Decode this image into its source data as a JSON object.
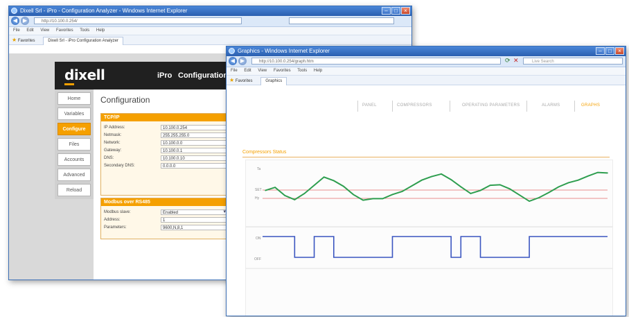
{
  "window1": {
    "title": "Dixell Srl - iPro - Configuration Analyzer - Windows Internet Explorer",
    "address": "http://10.100.0.254/",
    "menu": [
      "File",
      "Edit",
      "View",
      "Favorites",
      "Tools",
      "Help"
    ],
    "favorites_label": "Favorites",
    "tab_label": "Dixell Srl - iPro Configuration Analyzer",
    "header": {
      "logo": "dixell",
      "product": "iPro",
      "section": "Configuration"
    },
    "sidebar": [
      {
        "label": "Home",
        "active": false
      },
      {
        "label": "Variables",
        "active": false
      },
      {
        "label": "Configure",
        "active": true
      },
      {
        "label": "Files",
        "active": false
      },
      {
        "label": "Accounts",
        "active": false
      },
      {
        "label": "Advanced",
        "active": false
      },
      {
        "label": "Reload",
        "active": false
      }
    ],
    "page_title": "Configuration",
    "tcpip": {
      "title": "TCP/IP",
      "rows": [
        {
          "label": "IP Address:",
          "value": "10.100.0.254"
        },
        {
          "label": "Netmask:",
          "value": "255.255.255.0"
        },
        {
          "label": "Network:",
          "value": "10.100.0.0"
        },
        {
          "label": "Gateway:",
          "value": "10.100.0.1"
        },
        {
          "label": "DNS:",
          "value": "10.100.0.10"
        },
        {
          "label": "Secondary DNS:",
          "value": "0.0.0.0"
        }
      ]
    },
    "modbus": {
      "title": "Modbus over RS485",
      "rows": [
        {
          "label": "Modbus slave:",
          "value": "Enabled"
        },
        {
          "label": "Address:",
          "value": "1"
        },
        {
          "label": "Parameters:",
          "value": "9600,N,8,1"
        }
      ]
    }
  },
  "window2": {
    "title": "Graphics - Windows Internet Explorer",
    "address": "http://10.100.0.254/graph.htm",
    "search_placeholder": "Live Search",
    "menu": [
      "File",
      "Edit",
      "View",
      "Favorites",
      "Tools",
      "Help"
    ],
    "favorites_label": "Favorites",
    "tab_label": "Graphics",
    "nav": [
      {
        "label": "PANEL",
        "active": false
      },
      {
        "label": "COMPRESSORS",
        "active": false
      },
      {
        "label": "OPERATING PARAMETERS",
        "active": false
      },
      {
        "label": "ALARMS",
        "active": false
      },
      {
        "label": "GRAPHS",
        "active": true
      }
    ],
    "chart_title": "Compressors Status",
    "y_labels": {
      "top": "Ta",
      "upper_ref": "SET",
      "lower_ref": "Hy",
      "on": "ON",
      "off": "OFF"
    }
  },
  "chart_data": {
    "type": "line",
    "title": "Compressors Status",
    "series": [
      {
        "name": "",
        "color": "#2e9e4f",
        "values": [
          0.52,
          0.58,
          0.42,
          0.34,
          0.46,
          0.62,
          0.78,
          0.71,
          0.6,
          0.44,
          0.33,
          0.36,
          0.36,
          0.44,
          0.5,
          0.61,
          0.72,
          0.79,
          0.84,
          0.73,
          0.59,
          0.46,
          0.52,
          0.62,
          0.63,
          0.55,
          0.43,
          0.31,
          0.38,
          0.48,
          0.59,
          0.67,
          0.72,
          0.8,
          0.87,
          0.86
        ]
      },
      {
        "name": "",
        "color": "#3a55c0",
        "step": true,
        "values": [
          1,
          1,
          1,
          0,
          0,
          1,
          1,
          0,
          0,
          0,
          0,
          0,
          0,
          1,
          1,
          1,
          1,
          1,
          1,
          0,
          1,
          1,
          0,
          0,
          0,
          0,
          0,
          1,
          1,
          1,
          1,
          1,
          1,
          1,
          1,
          1
        ]
      }
    ],
    "reference_lines": [
      {
        "label": "SET",
        "color": "#e26a6a"
      },
      {
        "label": "Hy",
        "color": "#e26a6a"
      }
    ],
    "colors": {
      "accent": "#f5a000",
      "window_frame": "#3b6fb5"
    }
  }
}
